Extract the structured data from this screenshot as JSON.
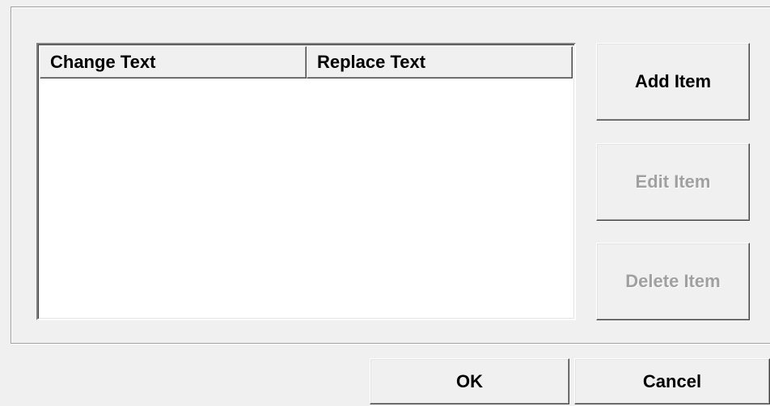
{
  "listview": {
    "columns": [
      "Change Text",
      "Replace Text"
    ],
    "rows": []
  },
  "side_buttons": {
    "add_label": "Add Item",
    "edit_label": "Edit Item",
    "delete_label": "Delete Item"
  },
  "footer_buttons": {
    "ok_label": "OK",
    "cancel_label": "Cancel"
  },
  "colors": {
    "dialog_bg": "#f0f0f0",
    "list_bg": "#ffffff",
    "disabled_text": "#a0a0a0"
  }
}
